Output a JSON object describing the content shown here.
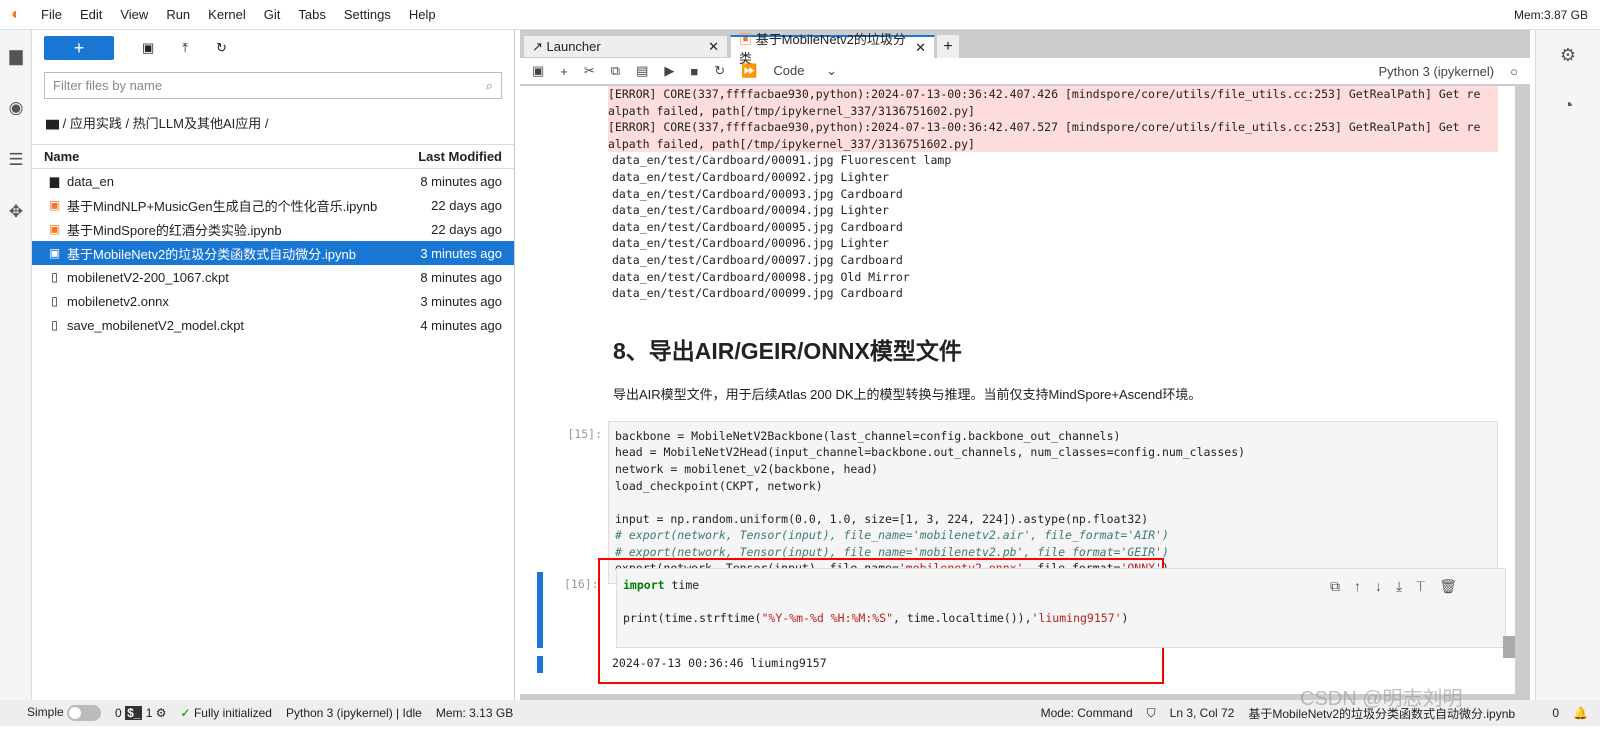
{
  "menu": [
    "File",
    "Edit",
    "View",
    "Run",
    "Kernel",
    "Git",
    "Tabs",
    "Settings",
    "Help"
  ],
  "mem_top": "Mem:3.87 GB",
  "browser": {
    "search_placeholder": "Filter files by name",
    "breadcrumb": "/ 应用实践 / 热门LLM及其他AI应用 /",
    "col_name": "Name",
    "col_modified": "Last Modified",
    "files": [
      {
        "name": "data_en",
        "modified": "8 minutes ago",
        "icon": "folder-icon"
      },
      {
        "name": "基于MindNLP+MusicGen生成自己的个性化音乐.ipynb",
        "modified": "22 days ago",
        "icon": "notebook-icon"
      },
      {
        "name": "基于MindSpore的红酒分类实验.ipynb",
        "modified": "22 days ago",
        "icon": "notebook-icon"
      },
      {
        "name": "基于MobileNetv2的垃圾分类函数式自动微分.ipynb",
        "modified": "3 minutes ago",
        "icon": "notebook-icon",
        "selected": true
      },
      {
        "name": "mobilenetV2-200_1067.ckpt",
        "modified": "8 minutes ago",
        "icon": "file-icon"
      },
      {
        "name": "mobilenetv2.onnx",
        "modified": "3 minutes ago",
        "icon": "file-icon"
      },
      {
        "name": "save_mobilenetV2_model.ckpt",
        "modified": "4 minutes ago",
        "icon": "file-icon"
      }
    ]
  },
  "tabs": [
    {
      "label": "Launcher"
    },
    {
      "label": "基于MobileNetv2的垃圾分类"
    }
  ],
  "toolbar": {
    "cell_type": "Code",
    "kernel": "Python 3 (ipykernel)"
  },
  "notebook": {
    "error_lines": [
      "[ERROR] CORE(337,ffffacbae930,python):2024-07-13-00:36:42.407.426 [mindspore/core/utils/file_utils.cc:253] GetRealPath] Get re",
      "alpath failed, path[/tmp/ipykernel_337/3136751602.py]",
      "[ERROR] CORE(337,ffffacbae930,python):2024-07-13-00:36:42.407.527 [mindspore/core/utils/file_utils.cc:253] GetRealPath] Get re",
      "alpath failed, path[/tmp/ipykernel_337/3136751602.py]"
    ],
    "output_lines": [
      "data_en/test/Cardboard/00091.jpg Fluorescent lamp",
      "data_en/test/Cardboard/00092.jpg Lighter",
      "data_en/test/Cardboard/00093.jpg Cardboard",
      "data_en/test/Cardboard/00094.jpg Lighter",
      "data_en/test/Cardboard/00095.jpg Cardboard",
      "data_en/test/Cardboard/00096.jpg Lighter",
      "data_en/test/Cardboard/00097.jpg Cardboard",
      "data_en/test/Cardboard/00098.jpg Old Mirror",
      "data_en/test/Cardboard/00099.jpg Cardboard"
    ],
    "heading": "8、导出AIR/GEIR/ONNX模型文件",
    "markdown": "导出AIR模型文件，用于后续Atlas 200 DK上的模型转换与推理。当前仅支持MindSpore+Ascend环境。",
    "cell15": {
      "prompt": "[15]:",
      "lines": [
        "backbone = MobileNetV2Backbone(last_channel=config.backbone_out_channels)",
        "head = MobileNetV2Head(input_channel=backbone.out_channels, num_classes=config.num_classes)",
        "network = mobilenet_v2(backbone, head)",
        "load_checkpoint(CKPT, network)",
        "",
        "input = np.random.uniform(0.0, 1.0, size=[1, 3, 224, 224]).astype(np.float32)",
        "# export(network, Tensor(input), file_name='mobilenetv2.air', file_format='AIR')",
        "# export(network, Tensor(input), file_name='mobilenetv2.pb', file_format='GEIR')",
        "export(network, Tensor(input), file_name='mobilenetv2.onnx', file_format='ONNX')"
      ]
    },
    "cell16": {
      "prompt": "[16]:",
      "lines": [
        "import time",
        "",
        "print(time.strftime(\"%Y-%m-%d %H:%M:%S\", time.localtime()),'liuming9157')"
      ],
      "output": "2024-07-13 00:36:46 liuming9157"
    }
  },
  "status": {
    "mode_simple": "Simple",
    "terminals": "0",
    "kernels": "1",
    "init": "Fully initialized",
    "kernel": "Python 3 (ipykernel) | Idle",
    "mem": "Mem: 3.13 GB",
    "mode": "Mode: Command",
    "position": "Ln 3, Col 72",
    "file": "基于MobileNetv2的垃圾分类函数式自动微分.ipynb",
    "notifications": "0"
  },
  "watermark": "CSDN @明志刘明",
  "colors": {
    "accent": "#1976d2",
    "error_bg": "#ffdddd",
    "highlight_box": "#ff0000"
  }
}
